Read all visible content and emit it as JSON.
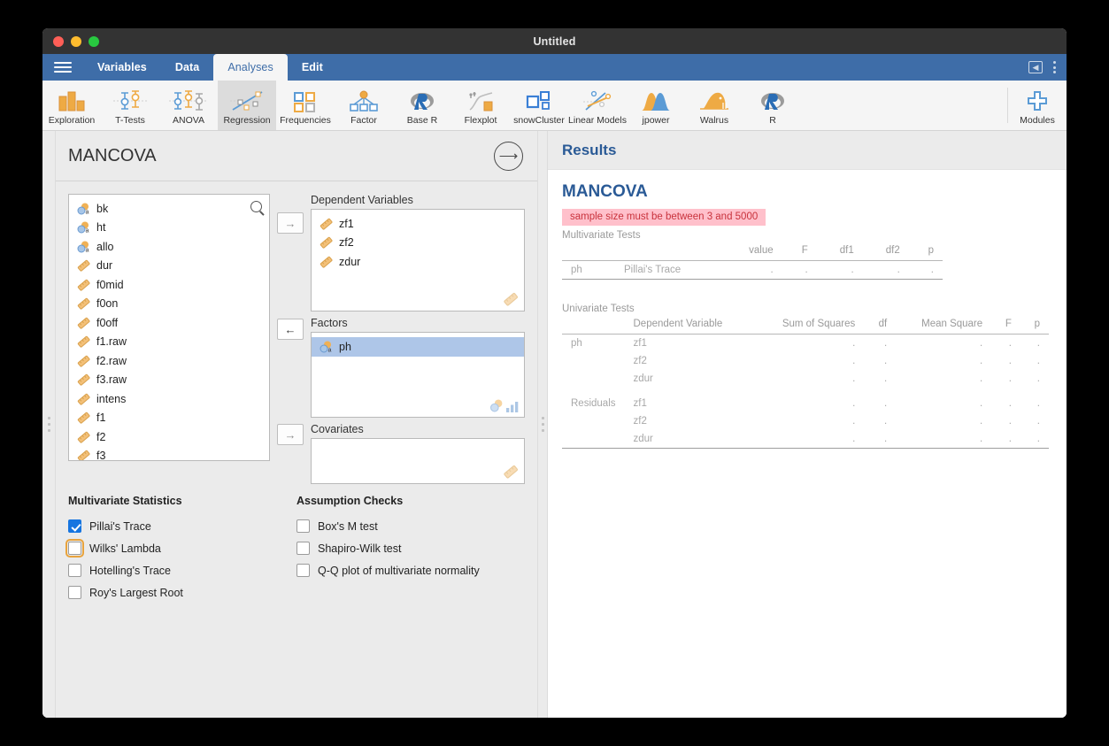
{
  "window": {
    "title": "Untitled",
    "traffic_lights": [
      "close",
      "minimize",
      "zoom"
    ]
  },
  "menu": {
    "hamburger": "menu-icon",
    "tabs": [
      {
        "label": "Variables",
        "active": false
      },
      {
        "label": "Data",
        "active": false
      },
      {
        "label": "Analyses",
        "active": true
      },
      {
        "label": "Edit",
        "active": false
      }
    ],
    "right_icons": [
      "panel-collapse-icon",
      "kebab-menu-icon"
    ]
  },
  "toolbar": {
    "items": [
      {
        "label": "Exploration",
        "icon": "exploration-icon",
        "selected": false
      },
      {
        "label": "T-Tests",
        "icon": "t-tests-icon",
        "selected": false
      },
      {
        "label": "ANOVA",
        "icon": "anova-icon",
        "selected": false
      },
      {
        "label": "Regression",
        "icon": "regression-icon",
        "selected": true
      },
      {
        "label": "Frequencies",
        "icon": "frequencies-icon",
        "selected": false
      },
      {
        "label": "Factor",
        "icon": "factor-icon",
        "selected": false
      },
      {
        "label": "Base R",
        "icon": "r-logo-icon",
        "selected": false
      },
      {
        "label": "Flexplot",
        "icon": "flexplot-icon",
        "selected": false
      },
      {
        "label": "snowCluster",
        "icon": "snowcluster-icon",
        "selected": false
      },
      {
        "label": "Linear Models",
        "icon": "linear-models-icon",
        "selected": false
      },
      {
        "label": "jpower",
        "icon": "jpower-icon",
        "selected": false
      },
      {
        "label": "Walrus",
        "icon": "walrus-icon",
        "selected": false
      },
      {
        "label": "R",
        "icon": "r-logo-icon",
        "selected": false
      }
    ],
    "modules": {
      "label": "Modules",
      "icon": "plus-icon"
    }
  },
  "options": {
    "title": "MANCOVA",
    "close_button": "arrow-right-circle-icon",
    "variable_list": {
      "search_placeholder": "",
      "items": [
        {
          "name": "bk",
          "type": "nominal-text"
        },
        {
          "name": "ht",
          "type": "nominal-text"
        },
        {
          "name": "allo",
          "type": "nominal-text"
        },
        {
          "name": "dur",
          "type": "continuous"
        },
        {
          "name": "f0mid",
          "type": "continuous"
        },
        {
          "name": "f0on",
          "type": "continuous"
        },
        {
          "name": "f0off",
          "type": "continuous"
        },
        {
          "name": "f1.raw",
          "type": "continuous"
        },
        {
          "name": "f2.raw",
          "type": "continuous"
        },
        {
          "name": "f3.raw",
          "type": "continuous"
        },
        {
          "name": "intens",
          "type": "continuous"
        },
        {
          "name": "f1",
          "type": "continuous"
        },
        {
          "name": "f2",
          "type": "continuous"
        },
        {
          "name": "f3",
          "type": "continuous"
        }
      ]
    },
    "dependent_variables": {
      "label": "Dependent Variables",
      "items": [
        {
          "name": "zf1",
          "type": "continuous"
        },
        {
          "name": "zf2",
          "type": "continuous"
        },
        {
          "name": "zdur",
          "type": "continuous"
        }
      ]
    },
    "factors": {
      "label": "Factors",
      "items": [
        {
          "name": "ph",
          "type": "nominal-text",
          "selected": true
        }
      ]
    },
    "covariates": {
      "label": "Covariates",
      "items": []
    },
    "arrows": {
      "to_dependent": "→",
      "to_source": "←",
      "to_covariates": "→"
    },
    "multivariate_statistics": {
      "title": "Multivariate Statistics",
      "options": [
        {
          "label": "Pillai's Trace",
          "checked": true,
          "focused": false
        },
        {
          "label": "Wilks' Lambda",
          "checked": false,
          "focused": true
        },
        {
          "label": "Hotelling's Trace",
          "checked": false,
          "focused": false
        },
        {
          "label": "Roy's Largest Root",
          "checked": false,
          "focused": false
        }
      ]
    },
    "assumption_checks": {
      "title": "Assumption Checks",
      "options": [
        {
          "label": "Box's M test",
          "checked": false,
          "focused": false
        },
        {
          "label": "Shapiro-Wilk test",
          "checked": false,
          "focused": false
        },
        {
          "label": "Q-Q plot of multivariate normality",
          "checked": false,
          "focused": false
        }
      ]
    }
  },
  "results": {
    "header": "Results",
    "analysis_title": "MANCOVA",
    "error_message": "sample size must be between 3 and 5000",
    "multivariate_tests": {
      "caption": "Multivariate Tests",
      "columns": [
        "",
        "",
        "value",
        "F",
        "df1",
        "df2",
        "p"
      ],
      "rows": [
        [
          "ph",
          "Pillai's Trace",
          ".",
          ".",
          ".",
          ".",
          "."
        ]
      ]
    },
    "univariate_tests": {
      "caption": "Univariate Tests",
      "columns": [
        "",
        "Dependent Variable",
        "Sum of Squares",
        "df",
        "Mean Square",
        "F",
        "p"
      ],
      "rows": [
        [
          "ph",
          "zf1",
          ".",
          ".",
          ".",
          ".",
          "."
        ],
        [
          "",
          "zf2",
          ".",
          ".",
          ".",
          ".",
          "."
        ],
        [
          "",
          "zdur",
          ".",
          ".",
          ".",
          ".",
          "."
        ],
        [
          "Residuals",
          "zf1",
          ".",
          ".",
          ".",
          ".",
          "."
        ],
        [
          "",
          "zf2",
          ".",
          ".",
          ".",
          ".",
          "."
        ],
        [
          "",
          "zdur",
          ".",
          ".",
          ".",
          ".",
          "."
        ]
      ]
    }
  },
  "colors": {
    "ribbon_blue": "#3e6da8",
    "accent_orange": "#eeaa44",
    "accent_blue": "#5b9bd5",
    "selection_blue": "#aec6e8",
    "error_bg": "#ffc0cb",
    "error_text": "#c8323c",
    "heading_blue": "#2a5a96"
  }
}
